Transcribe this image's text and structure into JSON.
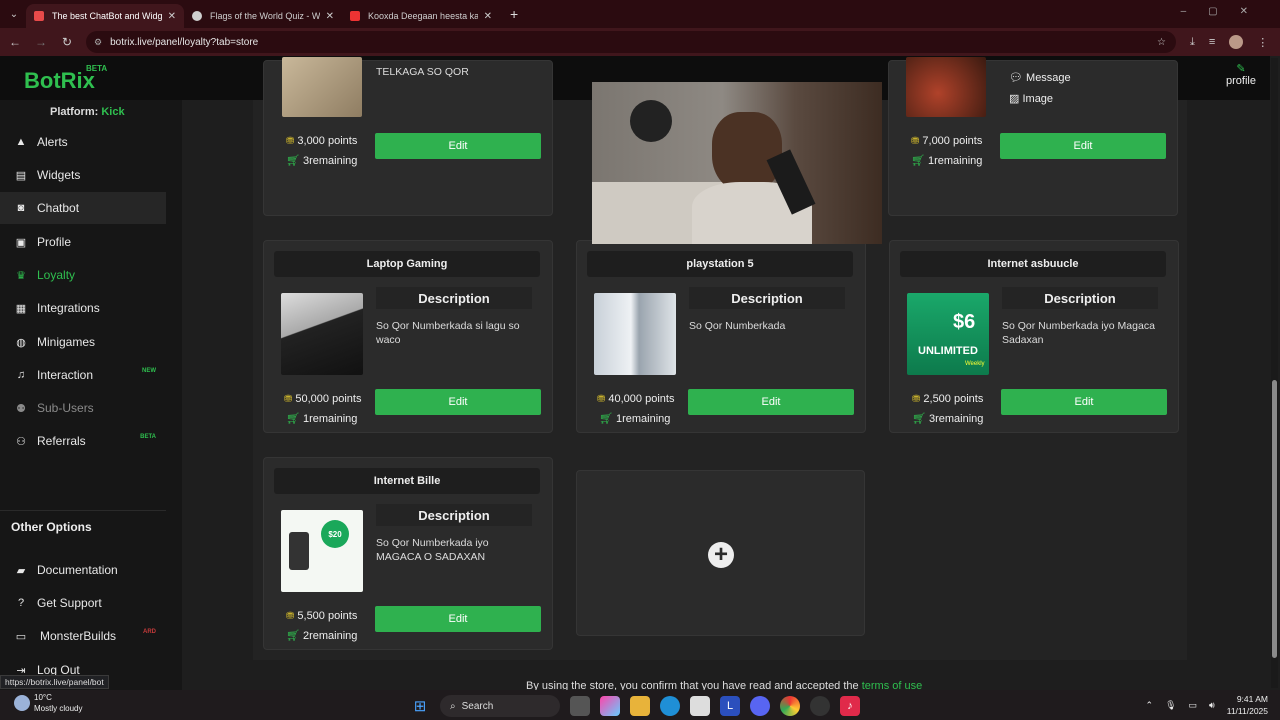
{
  "browser": {
    "tabs": [
      {
        "title": "The best ChatBot and Widgets",
        "color": "#e84a4a"
      },
      {
        "title": "Flags of the World Quiz - World",
        "color": "#cfcfcf"
      },
      {
        "title": "Kooxda Deegaan heesta kacda",
        "color": "#e33"
      }
    ],
    "url": "botrix.live/panel/loyalty?tab=store",
    "status_url": "https://botrix.live/panel/bot"
  },
  "app": {
    "logo": "BotRix",
    "logo_badge": "BETA",
    "profile_label": "profile",
    "platform_label": "Platform:",
    "platform_value": "Kick",
    "nav": [
      {
        "label": "Alerts",
        "icon": "warning-icon"
      },
      {
        "label": "Widgets",
        "icon": "widgets-icon"
      },
      {
        "label": "Chatbot",
        "icon": "robot-icon"
      },
      {
        "label": "Profile",
        "icon": "profile-card-icon"
      },
      {
        "label": "Loyalty",
        "icon": "trophy-icon"
      },
      {
        "label": "Integrations",
        "icon": "integrations-icon"
      },
      {
        "label": "Minigames",
        "icon": "gamepad-icon"
      },
      {
        "label": "Interaction",
        "icon": "music-icon",
        "tag": "NEW"
      },
      {
        "label": "Sub-Users",
        "icon": "users-icon"
      },
      {
        "label": "Referrals",
        "icon": "referral-icon",
        "tag": "BETA"
      }
    ],
    "other_title": "Other Options",
    "other": [
      {
        "label": "Documentation",
        "icon": "book-icon"
      },
      {
        "label": "Get Support",
        "icon": "help-icon"
      },
      {
        "label": "MonsterBuilds",
        "icon": "laptop-icon",
        "tag": "ARD"
      },
      {
        "label": "Log Out",
        "icon": "logout-icon"
      }
    ]
  },
  "store": {
    "top_cards": [
      {
        "desc": "TELKAGA SO QOR",
        "points": "3,000 points",
        "remaining": "3remaining",
        "edit": "Edit"
      },
      {
        "points": "7,000 points",
        "remaining": "1remaining",
        "edit": "Edit",
        "options": [
          "Message",
          "Image"
        ]
      }
    ],
    "cards": [
      {
        "title": "Laptop Gaming",
        "desc_title": "Description",
        "desc": "So Qor Numberkada si lagu so waco",
        "points": "50,000 points",
        "remaining": "1remaining",
        "edit": "Edit"
      },
      {
        "title": "playstation 5",
        "desc_title": "Description",
        "desc": "So Qor Numberkada",
        "points": "40,000 points",
        "remaining": "1remaining",
        "edit": "Edit"
      },
      {
        "title": "Internet asbuucle",
        "desc_title": "Description",
        "desc": "So Qor Numberkada iyo Magaca Sadaxan",
        "points": "2,500 points",
        "remaining": "3remaining",
        "edit": "Edit"
      },
      {
        "title": "Internet Bille",
        "desc_title": "Description",
        "desc": "So Qor Numberkada iyo MAGACA O SADAXAN",
        "points": "5,500 points",
        "remaining": "2remaining",
        "edit": "Edit"
      }
    ],
    "thumb_texts": {
      "unlimited": "UNLIMITED",
      "price": "$6",
      "weekly": "Weekly",
      "bille_price": "$20"
    },
    "footer": "By using the store, you confirm that you have read and accepted the",
    "footer_link": "terms of use"
  },
  "taskbar": {
    "temp": "10°C",
    "weather": "Mostly cloudy",
    "search": "Search",
    "time": "9:41 AM",
    "date": "11/11/2025"
  }
}
